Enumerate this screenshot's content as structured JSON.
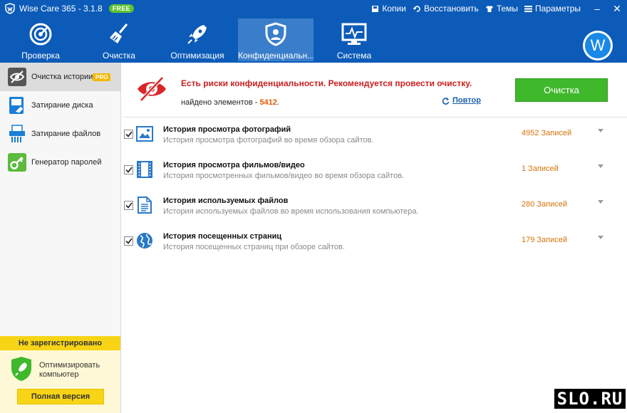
{
  "titlebar": {
    "title": "Wise Care 365 - 3.1.8",
    "badge": "FREE",
    "links": [
      {
        "label": "Копии",
        "icon": "backup-icon"
      },
      {
        "label": "Восстановить",
        "icon": "restore-icon"
      },
      {
        "label": "Темы",
        "icon": "shirt-icon"
      },
      {
        "label": "Параметры",
        "icon": "menu-icon"
      }
    ],
    "minimize": "–",
    "close": "✕"
  },
  "toolbar": {
    "items": [
      {
        "label": "Проверка",
        "icon": "radar-icon",
        "active": false
      },
      {
        "label": "Очистка",
        "icon": "broom-icon",
        "active": false
      },
      {
        "label": "Оптимизация",
        "icon": "rocket-icon",
        "active": false
      },
      {
        "label": "Конфиденциальн...",
        "icon": "privacy-shield-icon",
        "active": true
      },
      {
        "label": "Система",
        "icon": "monitor-icon",
        "active": false
      }
    ],
    "avatar_letter": "W"
  },
  "sidebar": {
    "items": [
      {
        "label": "Очистка истории",
        "icon": "eye-icon",
        "active": true,
        "badge": "PRO"
      },
      {
        "label": "Затирание диска",
        "icon": "disk-eraser-icon",
        "active": false
      },
      {
        "label": "Затирание файлов",
        "icon": "file-shredder-icon",
        "active": false
      },
      {
        "label": "Генератор паролей",
        "icon": "key-icon",
        "active": false
      }
    ],
    "registration": {
      "header": "Не зарегистрировано",
      "text_line1": "Оптимизировать",
      "text_line2": "компьютер",
      "button": "Полная версия"
    }
  },
  "risk": {
    "title": "Есть риски конфиденциальности. Рекомендуется провести очистку.",
    "found_prefix": "найдено элементов - ",
    "found_count": "5412",
    "found_suffix": ".",
    "retry": "Повтор",
    "clean_button": "Очистка"
  },
  "items": [
    {
      "title": "История просмотра фотографий",
      "desc": "История просмотра фотографий во время обзора сайтов.",
      "count": "4952 Записей",
      "checked": true,
      "icon": "photo-icon"
    },
    {
      "title": "История просмотра фильмов/видео",
      "desc": "История просмотренных фильмов/видео во время обзора сайтов.",
      "count": "1 Записей",
      "checked": true,
      "icon": "film-icon"
    },
    {
      "title": "История используемых файлов",
      "desc": "История используемых файлов во время использования компьютера.",
      "count": "280 Записей",
      "checked": true,
      "icon": "document-icon"
    },
    {
      "title": "История посещенных страниц",
      "desc": "История посещенных страниц при обзоре сайтов.",
      "count": "179 Записей",
      "checked": true,
      "icon": "globe-icon"
    }
  ],
  "watermark": "SLO.RU"
}
